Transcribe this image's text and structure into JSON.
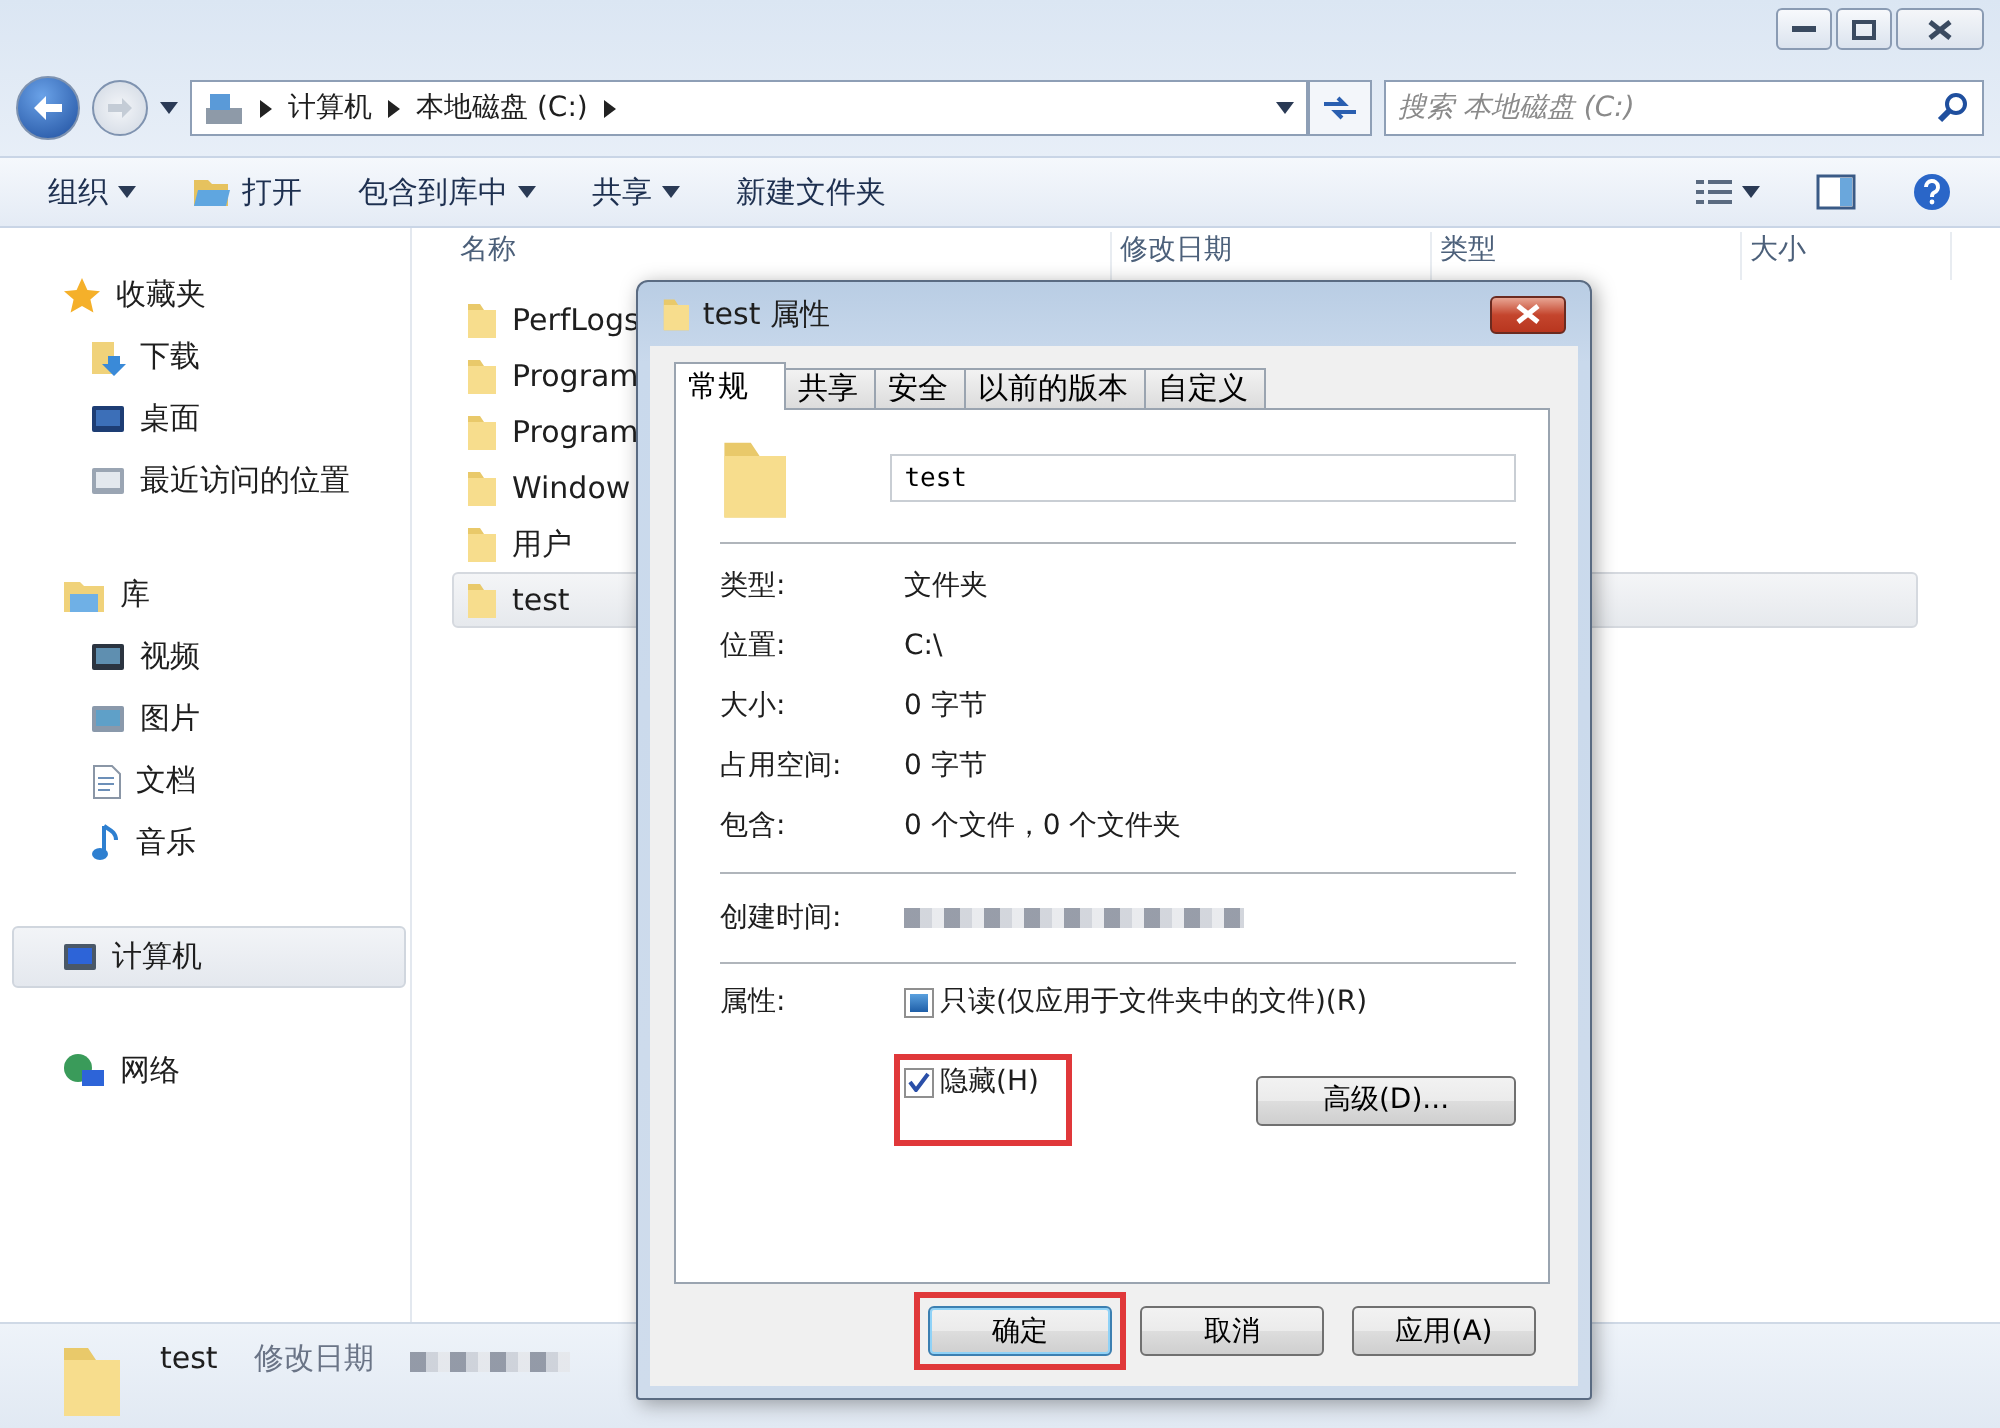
{
  "address": {
    "crumbs": [
      "计算机",
      "本地磁盘 (C:)"
    ]
  },
  "search": {
    "placeholder": "搜索 本地磁盘 (C:)"
  },
  "toolbar": {
    "items": [
      {
        "label": "组织",
        "kind": "menu"
      },
      {
        "label": "打开",
        "kind": "open"
      },
      {
        "label": "包含到库中",
        "kind": "menu"
      },
      {
        "label": "共享",
        "kind": "menu"
      },
      {
        "label": "新建文件夹",
        "kind": "plain"
      }
    ]
  },
  "sidebar": {
    "groups": [
      {
        "label": "收藏夹",
        "selected": false,
        "children": [
          {
            "label": "下载",
            "selected": false
          },
          {
            "label": "桌面",
            "selected": false
          },
          {
            "label": "最近访问的位置",
            "selected": false
          }
        ]
      },
      {
        "label": "库",
        "selected": false,
        "children": [
          {
            "label": "视频",
            "selected": false
          },
          {
            "label": "图片",
            "selected": false
          },
          {
            "label": "文档",
            "selected": false
          },
          {
            "label": "音乐",
            "selected": false
          }
        ]
      },
      {
        "label": "计算机",
        "selected": true
      },
      {
        "label": "网络",
        "selected": false
      }
    ]
  },
  "file_list": {
    "columns": [
      "名称",
      "修改日期",
      "类型",
      "大小"
    ],
    "rows": [
      {
        "name": "PerfLogs",
        "selected": false
      },
      {
        "name": "Program",
        "selected": false
      },
      {
        "name": "Program",
        "selected": false
      },
      {
        "name": "Window",
        "selected": false
      },
      {
        "name": "用户",
        "selected": false
      },
      {
        "name": "test",
        "selected": true
      }
    ]
  },
  "dialog": {
    "title": "test 属性",
    "tabs": [
      {
        "label": "常规",
        "selected": true
      },
      {
        "label": "共享",
        "selected": false
      },
      {
        "label": "安全",
        "selected": false
      },
      {
        "label": "以前的版本",
        "selected": false
      },
      {
        "label": "自定义",
        "selected": false
      }
    ],
    "name_value": "test",
    "properties": [
      {
        "label": "类型:",
        "value": "文件夹"
      },
      {
        "label": "位置:",
        "value": "C:\\"
      },
      {
        "label": "大小:",
        "value": "0 字节"
      },
      {
        "label": "占用空间:",
        "value": "0 字节"
      },
      {
        "label": "包含:",
        "value": "0 个文件，0 个文件夹"
      }
    ],
    "created_label": "创建时间:",
    "attributes_label": "属性:",
    "attributes": [
      {
        "label": "只读(仅应用于文件夹中的文件)(R)",
        "checked": false,
        "indeterminate": true,
        "highlighted": false
      },
      {
        "label": "隐藏(H)",
        "checked": true,
        "indeterminate": false,
        "highlighted": true
      }
    ],
    "advanced_button": "高级(D)...",
    "buttons": [
      {
        "label": "确定",
        "default": true,
        "highlighted": true
      },
      {
        "label": "取消",
        "default": false,
        "highlighted": false
      },
      {
        "label": "应用(A)",
        "default": false,
        "highlighted": false
      }
    ]
  },
  "status_bar": {
    "name": "test",
    "date_label": "修改日期"
  }
}
